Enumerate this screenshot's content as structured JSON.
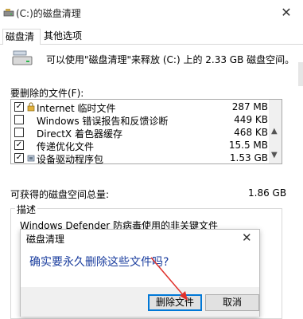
{
  "window": {
    "title": "(C:)的磁盘清理",
    "close_glyph": "✕"
  },
  "tabs": [
    {
      "label": "磁盘清理",
      "active": true
    },
    {
      "label": "其他选项",
      "active": false
    }
  ],
  "summary": "可以使用\"磁盘清理\"来释放 (C:) 上的 2.33 GB 磁盘空间。",
  "files_label": "要删除的文件(F):",
  "files": [
    {
      "checked": true,
      "icon": "lock-icon",
      "name": "Internet 临时文件",
      "size": "287 MB"
    },
    {
      "checked": false,
      "icon": "",
      "name": "Windows 错误报告和反馈诊断",
      "size": "449 KB"
    },
    {
      "checked": false,
      "icon": "",
      "name": "DirectX 着色器缓存",
      "size": "468 KB"
    },
    {
      "checked": true,
      "icon": "",
      "name": "传递优化文件",
      "size": "15.5 MB"
    },
    {
      "checked": true,
      "icon": "driver-icon",
      "name": "设备驱动程序包",
      "size": "1.53 GB"
    }
  ],
  "total": {
    "label": "可获得的磁盘空间总量:",
    "value": "1.86 GB"
  },
  "description": {
    "label": "描述",
    "text": "Windows Defender 防病毒使用的非关键文件"
  },
  "dialog": {
    "title": "磁盘清理",
    "close_glyph": "✕",
    "question": "确实要永久删除这些文件吗?",
    "confirm_label": "删除文件",
    "cancel_label": "取消"
  },
  "colors": {
    "accent": "#0078d7",
    "question_text": "#1a3d9e",
    "annotation_arrow": "#e0302b"
  }
}
